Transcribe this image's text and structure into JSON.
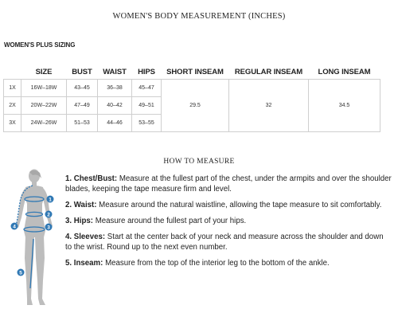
{
  "title": "WOMEN'S BODY MEASUREMENT (INCHES)",
  "subtitle": "WOMEN'S PLUS SIZING",
  "table": {
    "headers": [
      "SIZE",
      "BUST",
      "WAIST",
      "HIPS",
      "SHORT INSEAM",
      "REGULAR INSEAM",
      "LONG INSEAM"
    ],
    "rows": [
      {
        "label": "1X",
        "size": "16W–18W",
        "bust": "43–45",
        "waist": "36–38",
        "hips": "45–47"
      },
      {
        "label": "2X",
        "size": "20W–22W",
        "bust": "47–49",
        "waist": "40–42",
        "hips": "49–51"
      },
      {
        "label": "3X",
        "size": "24W–26W",
        "bust": "51–53",
        "waist": "44–46",
        "hips": "53–55"
      }
    ],
    "short_inseam": "29.5",
    "regular_inseam": "32",
    "long_inseam": "34.5"
  },
  "how_to": {
    "title": "HOW TO MEASURE",
    "steps": [
      {
        "label": "1. Chest/Bust:",
        "text": " Measure at the fullest part of the chest, under the armpits and over the shoulder blades, keeping the tape measure firm and level."
      },
      {
        "label": "2. Waist:",
        "text": " Measure around the natural waistline, allowing the tape measure to sit comfortably."
      },
      {
        "label": "3. Hips:",
        "text": " Measure around the fullest part of your hips."
      },
      {
        "label": "4. Sleeves:",
        "text": " Start at the center back of your neck and measure across the shoulder and down to the wrist. Round up to the next even number."
      },
      {
        "label": "5. Inseam:",
        "text": " Measure from the top of the interior leg to the bottom of the ankle."
      }
    ],
    "markers": [
      "1",
      "2",
      "3",
      "4",
      "5"
    ]
  },
  "colors": {
    "marker": "#2f78b4",
    "figure": "#b9b9b9",
    "border": "#cfcfcf"
  }
}
